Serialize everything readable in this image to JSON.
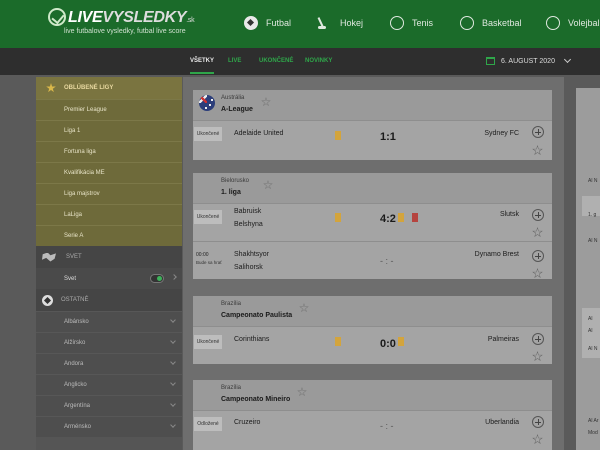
{
  "brand": {
    "logo_live": "LIVE",
    "logo_rest": "VYSLEDKY",
    "logo_tld": ".sk",
    "tagline": "live futbalove vysledky, futbal live score"
  },
  "sports": [
    {
      "label": "Futbal",
      "icon": "soccer-ball-icon"
    },
    {
      "label": "Hokej",
      "icon": "hockey-stick-icon"
    },
    {
      "label": "Tenis",
      "icon": "tennis-ball-icon"
    },
    {
      "label": "Basketbal",
      "icon": "basketball-icon"
    },
    {
      "label": "Volejbal",
      "icon": "volleyball-icon"
    }
  ],
  "tabs": [
    "VŠETKY",
    "LIVE",
    "UKONČENÉ",
    "NOVINKY"
  ],
  "date_label": "6. AUGUST 2020",
  "sidebar": {
    "favorites_title": "OBLÚBENÉ LIGY",
    "favorites": [
      "Premier League",
      "Liga 1",
      "Fortuna liga",
      "Kvalifikácia ME",
      "Liga majstrov",
      "LaLiga",
      "Serie A"
    ],
    "world_title": "SVET",
    "world_item": "Svet",
    "other_title": "OSTATNÉ",
    "others": [
      "Albánsko",
      "Alžírsko",
      "Andora",
      "Anglicko",
      "Argentína",
      "Arménsko"
    ]
  },
  "leagues": [
    {
      "country": "Austrália",
      "name": "A-League",
      "matches": [
        {
          "status": "Ukončené",
          "home": "Adelaide United",
          "away": "Sydney FC",
          "score": "1:1"
        }
      ]
    },
    {
      "country": "Bielorusko",
      "name": "1. liga",
      "matches": [
        {
          "status": "Ukončené",
          "home": "Babruisk",
          "home2": "Belshyna",
          "away": "Slutsk",
          "score": "4:2"
        },
        {
          "status": "00:00",
          "status2": "Bude sa hrať",
          "home": "Shakhtsyor",
          "home2": "Salihorsk",
          "away": "Dynamo Brest",
          "score": "- : -"
        }
      ]
    },
    {
      "country": "Brazília",
      "name": "Campeonato Paulista",
      "matches": [
        {
          "status": "Ukončené",
          "home": "Corinthians",
          "away": "Palmeiras",
          "score": "0:0"
        }
      ]
    },
    {
      "country": "Brazília",
      "name": "Campeonato Mineiro",
      "matches": [
        {
          "status": "Odložené",
          "home": "Cruzeiro",
          "away": "Uberlandia",
          "score": "- : -"
        }
      ]
    }
  ],
  "right_panel": [
    "Al N",
    "Al N",
    "1. g",
    "Al",
    "Al",
    "Al N",
    "Al Ar",
    "Mod"
  ]
}
